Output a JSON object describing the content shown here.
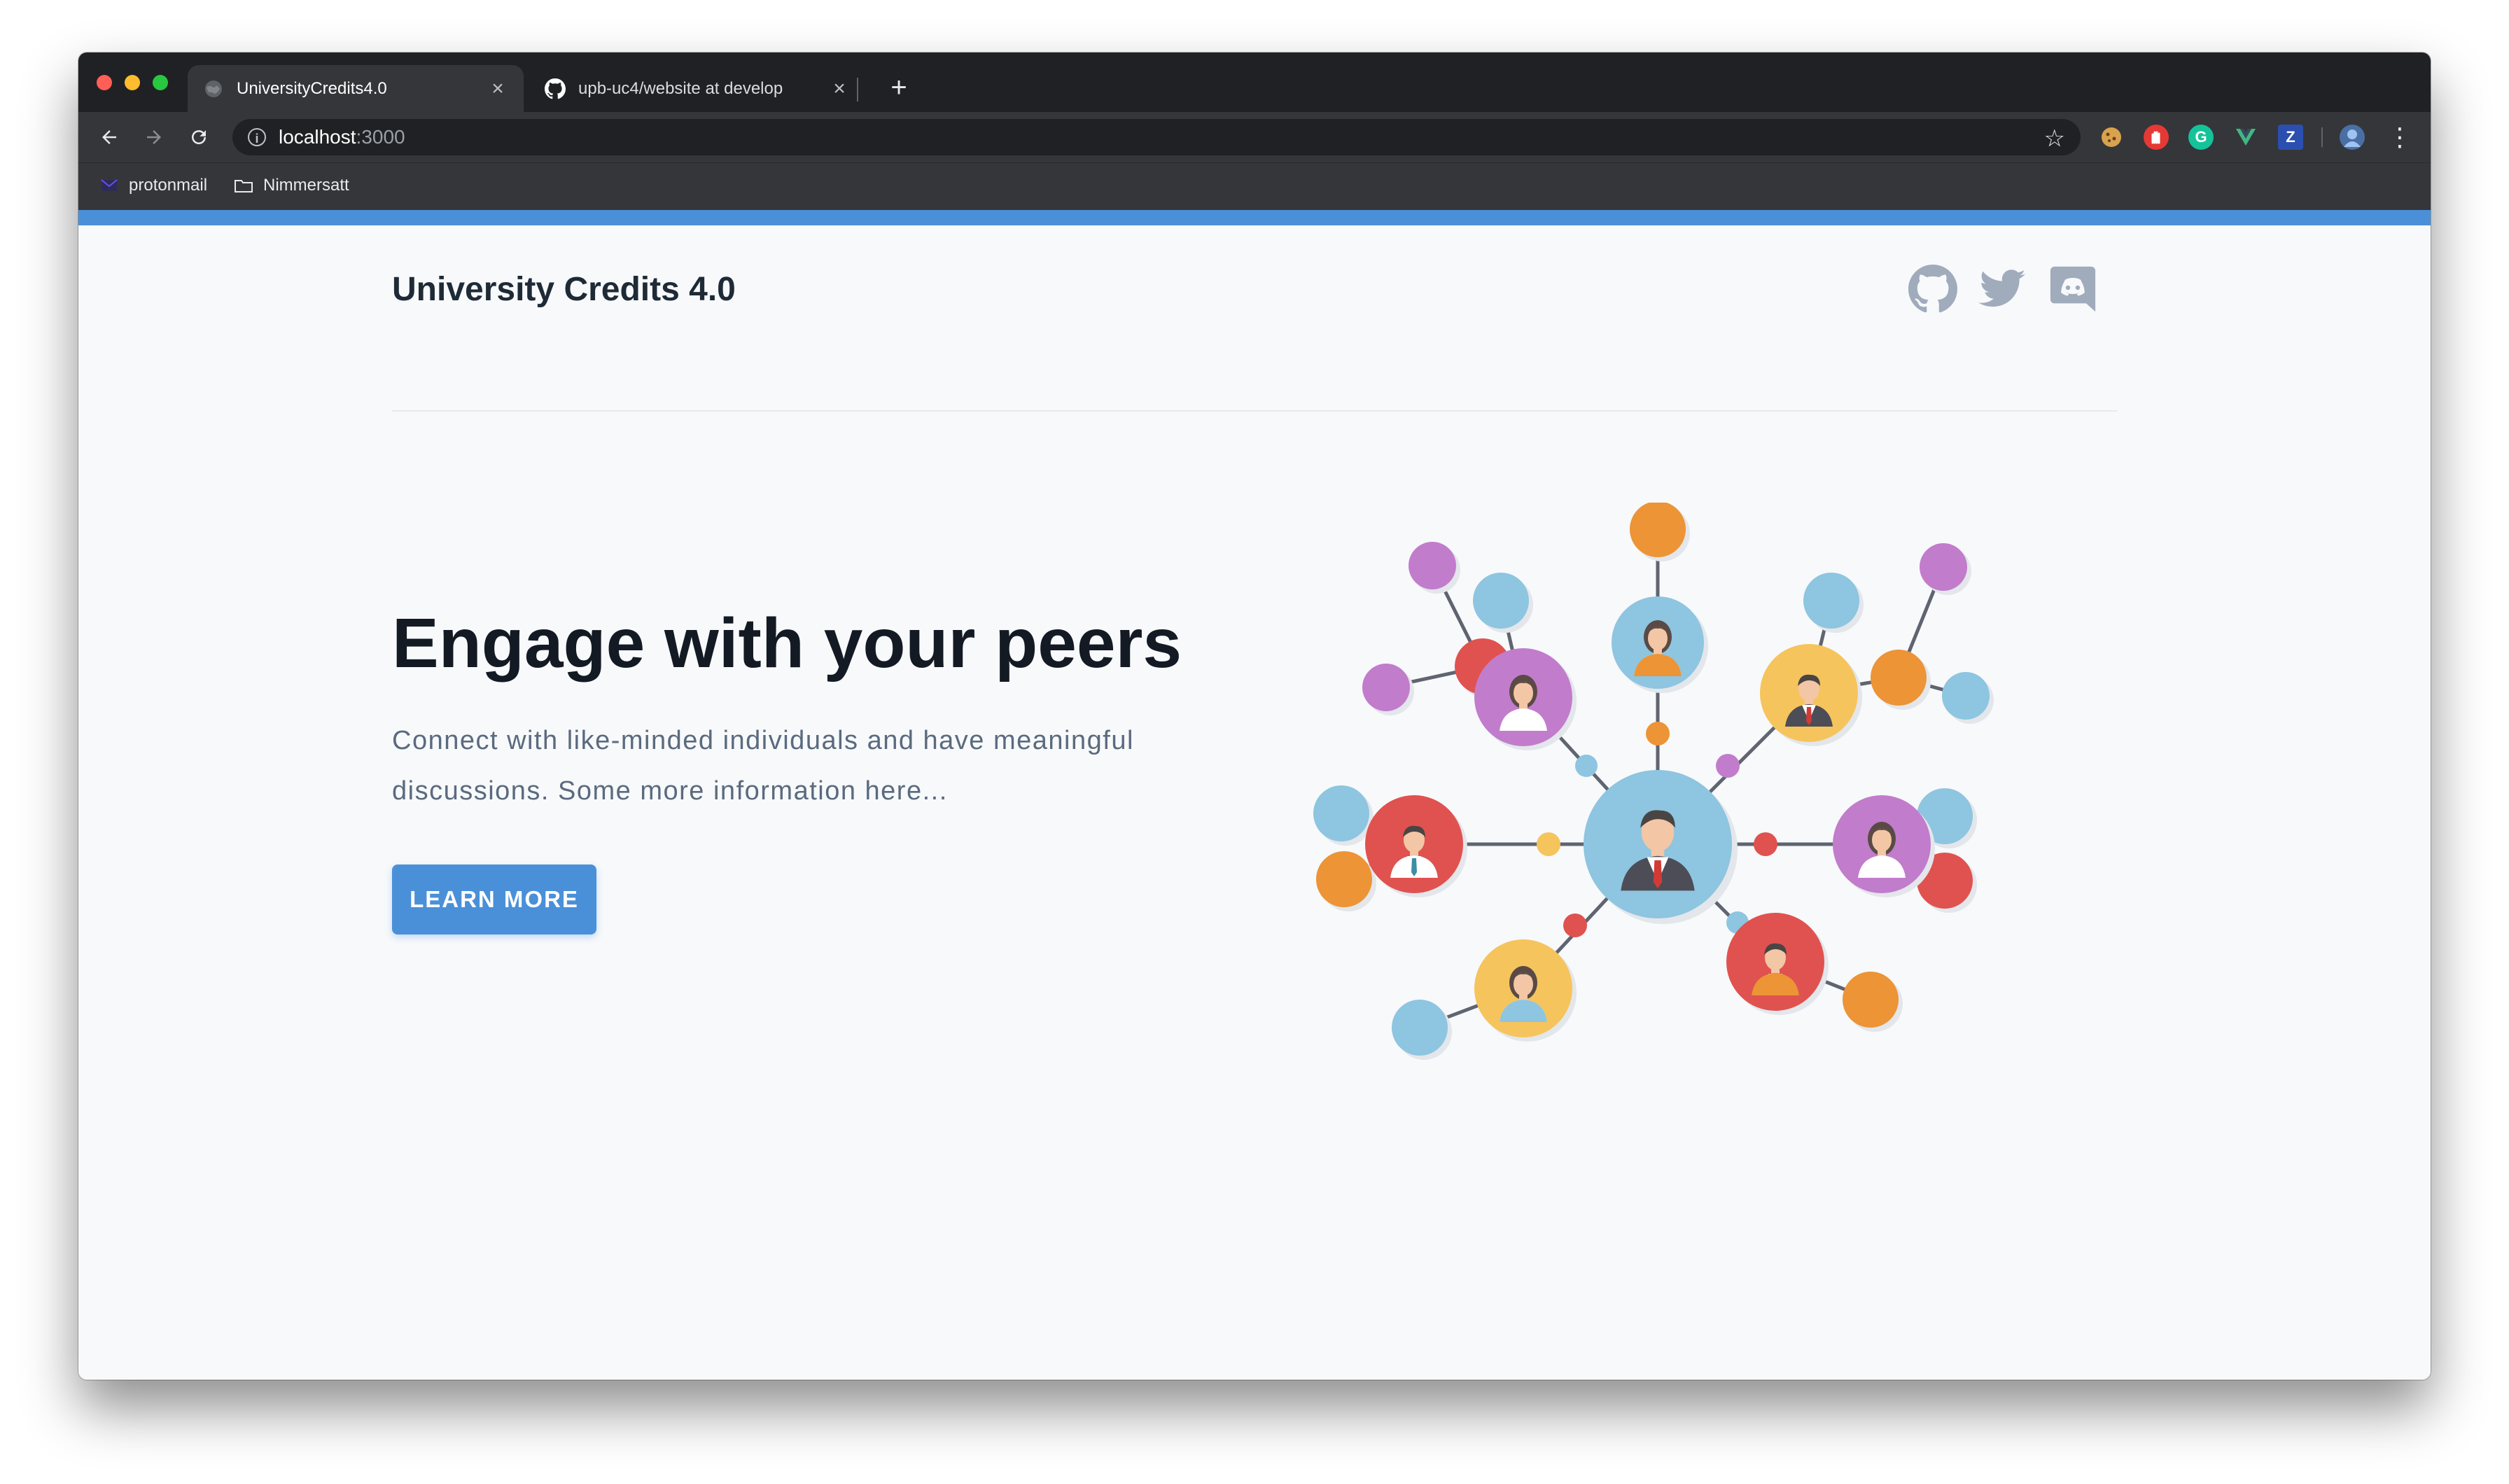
{
  "browser": {
    "tabs": [
      {
        "title": "UniversityCredits4.0",
        "active": true
      },
      {
        "title": "upb-uc4/website at develop",
        "active": false
      }
    ],
    "new_tab_symbol": "+",
    "close_symbol": "×",
    "address": {
      "host": "localhost",
      "port": ":3000"
    },
    "bookmarks": [
      {
        "label": "protonmail",
        "icon": "protonmail-icon"
      },
      {
        "label": "Nimmersatt",
        "icon": "folder-icon"
      }
    ],
    "extensions": [
      {
        "name": "cookie-extension-icon",
        "color": "#c48a3a",
        "glyph": "●"
      },
      {
        "name": "adblock-extension-icon",
        "color": "#e53935",
        "glyph": "✋"
      },
      {
        "name": "grammarly-extension-icon",
        "color": "#15c39a",
        "glyph": "G"
      },
      {
        "name": "vue-devtools-extension-icon",
        "color": "#41b883",
        "glyph": "V"
      },
      {
        "name": "zotero-extension-icon",
        "color": "#2b4fb0",
        "glyph": "Z"
      },
      {
        "name": "profile-avatar-icon",
        "color": "#5f8fd6",
        "glyph": "☺"
      }
    ]
  },
  "accent_color": "#4a90d9",
  "header": {
    "brand": "University Credits 4.0",
    "social_icons": [
      "github-icon",
      "twitter-icon",
      "discord-icon"
    ]
  },
  "hero": {
    "title": "Engage with your peers",
    "subtitle": "Connect with like-minded individuals and have meaningful discussions. Some more information here...",
    "cta_label": "LEARN MORE"
  },
  "illustration": {
    "name": "people-network-illustration",
    "palette": {
      "blue": "#8ec5e0",
      "purple": "#c27ccc",
      "orange": "#ec9436",
      "red": "#e0524f",
      "yellow": "#f6c45c"
    }
  }
}
